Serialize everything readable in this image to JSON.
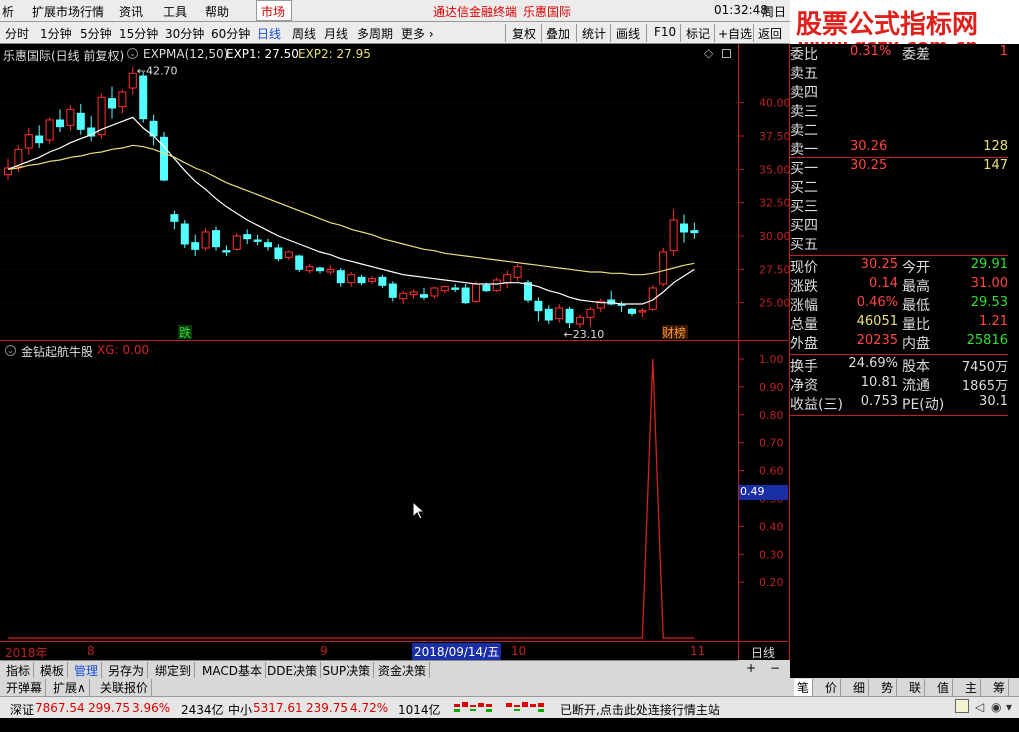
{
  "menu": {
    "items": [
      "析",
      "扩展市场行情",
      "资讯",
      "工具",
      "帮助"
    ],
    "market": "市场",
    "center": "通达信金融终端",
    "stock_title": "乐惠国际",
    "time": "01:32:48",
    "weekday": "周日"
  },
  "banner": {
    "line1": "股票公式指标网",
    "line2": "www.gszx.com.cn"
  },
  "toolbar": {
    "periods": [
      "分时",
      "1分钟",
      "5分钟",
      "15分钟",
      "30分钟",
      "60分钟",
      "日线",
      "周线",
      "月线",
      "多周期",
      "更多"
    ],
    "active": "日线",
    "right": [
      "复权",
      "叠加",
      "统计",
      "画线",
      "F10",
      "标记",
      "+自选",
      "返回"
    ]
  },
  "main_chart": {
    "header": "乐惠国际(日线 前复权)",
    "indicator": "EXPMA(12,50)",
    "exp1_label": "EXP1: 27.50",
    "exp2_label": "EXP2: 27.95",
    "high_label": "42.70",
    "low_label": "23.10",
    "tag_left": "跌",
    "tag_right": "财榜"
  },
  "indicator_chart": {
    "name": "金钻起航牛股",
    "value": "XG: 0.00",
    "cursor_value": "0.49"
  },
  "dates": {
    "year": "2018年",
    "m8": "8",
    "m9": "9",
    "cursor_date": "2018/09/14/五",
    "m10": "10",
    "m11": "11",
    "period": "日线"
  },
  "chart_data": [
    {
      "type": "candlestick",
      "title": "乐惠国际(日线 前复权)",
      "indicator": "EXPMA(12,50)",
      "ylim": [
        22.5,
        43.5
      ],
      "yticks": [
        25.0,
        27.5,
        30.0,
        32.5,
        35.0,
        37.5,
        40.0
      ],
      "ohlc": [
        [
          34.6,
          35.8,
          34.2,
          35.1
        ],
        [
          35.2,
          36.8,
          34.8,
          36.5
        ],
        [
          36.6,
          38.1,
          36.1,
          37.6
        ],
        [
          37.5,
          38.3,
          36.6,
          37.0
        ],
        [
          37.2,
          38.9,
          36.9,
          38.7
        ],
        [
          38.7,
          39.5,
          37.8,
          38.2
        ],
        [
          38.3,
          39.8,
          37.9,
          39.5
        ],
        [
          39.2,
          39.9,
          37.6,
          38.0
        ],
        [
          38.1,
          39.0,
          37.1,
          37.5
        ],
        [
          37.6,
          40.7,
          37.3,
          40.4
        ],
        [
          40.3,
          41.2,
          38.8,
          39.6
        ],
        [
          39.7,
          41.0,
          39.2,
          40.8
        ],
        [
          41.1,
          42.7,
          40.6,
          42.2
        ],
        [
          42.0,
          42.3,
          38.5,
          38.8
        ],
        [
          38.6,
          39.1,
          36.8,
          37.5
        ],
        [
          37.4,
          37.8,
          34.1,
          34.2
        ],
        [
          31.6,
          31.9,
          30.5,
          31.1
        ],
        [
          30.9,
          31.2,
          29.1,
          29.4
        ],
        [
          29.5,
          30.1,
          28.5,
          29.0
        ],
        [
          29.1,
          30.6,
          28.9,
          30.3
        ],
        [
          30.4,
          30.7,
          28.9,
          29.2
        ],
        [
          28.9,
          29.3,
          28.5,
          28.8
        ],
        [
          29.0,
          30.2,
          28.9,
          30.0
        ],
        [
          30.1,
          30.5,
          29.4,
          29.8
        ],
        [
          29.7,
          30.1,
          29.3,
          29.6
        ],
        [
          29.5,
          29.8,
          28.9,
          29.2
        ],
        [
          29.1,
          29.4,
          28.1,
          28.3
        ],
        [
          28.4,
          28.9,
          28.2,
          28.8
        ],
        [
          28.5,
          28.6,
          27.3,
          27.5
        ],
        [
          27.4,
          27.9,
          27.2,
          27.7
        ],
        [
          27.6,
          27.7,
          27.2,
          27.4
        ],
        [
          27.3,
          27.8,
          27.1,
          27.5
        ],
        [
          27.4,
          27.6,
          26.2,
          26.5
        ],
        [
          26.5,
          27.3,
          26.2,
          27.1
        ],
        [
          26.9,
          27.1,
          26.3,
          26.5
        ],
        [
          26.6,
          27.0,
          26.4,
          26.8
        ],
        [
          26.9,
          27.1,
          26.1,
          26.3
        ],
        [
          26.4,
          26.6,
          25.1,
          25.4
        ],
        [
          25.3,
          25.9,
          24.9,
          25.7
        ],
        [
          25.6,
          26.0,
          25.3,
          25.8
        ],
        [
          25.6,
          26.1,
          25.2,
          25.4
        ],
        [
          25.5,
          26.2,
          25.3,
          26.1
        ],
        [
          25.9,
          26.3,
          25.7,
          26.2
        ],
        [
          26.1,
          26.4,
          25.8,
          26.0
        ],
        [
          26.1,
          26.4,
          24.9,
          25.0
        ],
        [
          25.1,
          26.6,
          25.0,
          26.4
        ],
        [
          26.3,
          26.5,
          25.8,
          25.9
        ],
        [
          25.9,
          26.9,
          25.8,
          26.7
        ],
        [
          26.5,
          27.4,
          26.1,
          27.1
        ],
        [
          26.9,
          27.9,
          26.6,
          27.7
        ],
        [
          26.5,
          26.7,
          25.0,
          25.2
        ],
        [
          25.1,
          25.4,
          23.6,
          24.4
        ],
        [
          24.5,
          24.8,
          23.4,
          23.7
        ],
        [
          23.8,
          24.9,
          23.5,
          24.6
        ],
        [
          24.5,
          24.7,
          23.1,
          23.5
        ],
        [
          23.4,
          24.1,
          23.1,
          23.9
        ],
        [
          23.9,
          24.7,
          23.2,
          24.5
        ],
        [
          24.6,
          25.3,
          24.3,
          25.1
        ],
        [
          25.2,
          25.9,
          24.8,
          24.9
        ],
        [
          24.9,
          25.1,
          24.3,
          24.8
        ],
        [
          24.5,
          24.6,
          24.0,
          24.2
        ],
        [
          24.3,
          24.6,
          23.9,
          24.4
        ],
        [
          24.5,
          26.3,
          24.4,
          26.1
        ],
        [
          26.4,
          29.1,
          26.2,
          28.8
        ],
        [
          28.9,
          32.0,
          28.5,
          31.2
        ],
        [
          30.9,
          31.6,
          29.5,
          30.3
        ],
        [
          30.4,
          31.0,
          29.8,
          30.25
        ]
      ],
      "series": [
        {
          "name": "EXP1",
          "color": "#ffffff",
          "values": [
            35.0,
            35.3,
            35.6,
            35.9,
            36.3,
            36.6,
            37.0,
            37.3,
            37.6,
            38.0,
            38.3,
            38.6,
            38.9,
            38.1,
            37.5,
            36.7,
            35.8,
            34.9,
            34.1,
            33.5,
            32.8,
            32.2,
            31.7,
            31.2,
            30.8,
            30.4,
            30.0,
            29.7,
            29.4,
            29.1,
            28.8,
            28.6,
            28.3,
            28.1,
            27.9,
            27.7,
            27.5,
            27.3,
            27.1,
            27.0,
            26.9,
            26.8,
            26.7,
            26.6,
            26.5,
            26.4,
            26.4,
            26.4,
            26.5,
            26.5,
            26.4,
            26.2,
            25.9,
            25.7,
            25.4,
            25.2,
            25.1,
            25.0,
            25.0,
            24.9,
            24.9,
            24.9,
            25.2,
            25.8,
            26.5,
            27.0,
            27.5
          ]
        },
        {
          "name": "EXP2",
          "color": "#e8e07a",
          "values": [
            35.0,
            35.1,
            35.3,
            35.4,
            35.6,
            35.7,
            35.9,
            36.0,
            36.2,
            36.3,
            36.5,
            36.6,
            36.8,
            36.7,
            36.5,
            36.2,
            35.9,
            35.5,
            35.1,
            34.8,
            34.4,
            34.0,
            33.7,
            33.4,
            33.1,
            32.8,
            32.5,
            32.2,
            31.9,
            31.6,
            31.3,
            31.0,
            30.8,
            30.5,
            30.3,
            30.1,
            29.8,
            29.6,
            29.4,
            29.2,
            29.0,
            28.9,
            28.7,
            28.6,
            28.5,
            28.4,
            28.3,
            28.2,
            28.1,
            28.0,
            27.9,
            27.8,
            27.7,
            27.6,
            27.5,
            27.4,
            27.3,
            27.3,
            27.2,
            27.2,
            27.1,
            27.1,
            27.2,
            27.4,
            27.6,
            27.8,
            27.95
          ]
        }
      ]
    },
    {
      "type": "line",
      "title": "金钻起航牛股",
      "ylim": [
        0.0,
        1.05
      ],
      "yticks": [
        0.2,
        0.3,
        0.4,
        0.5,
        0.6,
        0.7,
        0.8,
        0.9,
        1.0
      ],
      "series": [
        {
          "name": "XG",
          "color": "#d22222",
          "values": [
            0,
            0,
            0,
            0,
            0,
            0,
            0,
            0,
            0,
            0,
            0,
            0,
            0,
            0,
            0,
            0,
            0,
            0,
            0,
            0,
            0,
            0,
            0,
            0,
            0,
            0,
            0,
            0,
            0,
            0,
            0,
            0,
            0,
            0,
            0,
            0,
            0,
            0,
            0,
            0,
            0,
            0,
            0,
            0,
            0,
            0,
            0,
            0,
            0,
            0,
            0,
            0,
            0,
            0,
            0,
            0,
            0,
            0,
            0,
            0,
            0,
            0,
            1,
            0,
            0,
            0,
            0
          ]
        }
      ]
    }
  ],
  "quote": {
    "top": [
      {
        "l": "委比",
        "v": "0.31%",
        "l2": "委差",
        "v2": "1"
      }
    ],
    "ask": [
      {
        "l": "卖五"
      },
      {
        "l": "卖四"
      },
      {
        "l": "卖三"
      },
      {
        "l": "卖二"
      },
      {
        "l": "卖一",
        "p": "30.26",
        "q": "128"
      }
    ],
    "bid": [
      {
        "l": "买一",
        "p": "30.25",
        "q": "147"
      },
      {
        "l": "买二"
      },
      {
        "l": "买三"
      },
      {
        "l": "买四"
      },
      {
        "l": "买五"
      }
    ],
    "stats": [
      {
        "l": "现价",
        "v": "30.25",
        "l2": "今开",
        "v2": "29.91",
        "c": "#ff4444",
        "c2": "#33dd33"
      },
      {
        "l": "涨跌",
        "v": "0.14",
        "l2": "最高",
        "v2": "31.00",
        "c": "#ff4444",
        "c2": "#ff4444"
      },
      {
        "l": "涨幅",
        "v": "0.46%",
        "l2": "最低",
        "v2": "29.53",
        "c": "#ff4444",
        "c2": "#33dd33"
      },
      {
        "l": "总量",
        "v": "46051",
        "l2": "量比",
        "v2": "1.21",
        "c": "#e8e07a",
        "c2": "#ff4444"
      },
      {
        "l": "外盘",
        "v": "20235",
        "l2": "内盘",
        "v2": "25816",
        "c": "#ff4444",
        "c2": "#33dd33"
      }
    ],
    "fin": [
      {
        "l": "换手",
        "v": "24.69%",
        "l2": "股本",
        "v2": "7450万"
      },
      {
        "l": "净资",
        "v": "10.81",
        "l2": "流通",
        "v2": "1865万"
      },
      {
        "l": "收益(三)",
        "v": "0.753",
        "l2": "PE(动)",
        "v2": "30.1"
      }
    ]
  },
  "tabs": [
    "指标",
    "模板",
    "管理",
    "另存为",
    "绑定到",
    "MACD基本",
    "DDE决策",
    "SUP决策",
    "资金决策"
  ],
  "tabs2": [
    "开弹幕",
    "扩展∧",
    "关联报价"
  ],
  "rtabs": [
    "笔",
    "价",
    "细",
    "势",
    "联",
    "值",
    "主",
    "筹"
  ],
  "status": {
    "sz_label": "深证",
    "sz_val": "7867.54",
    "sz_chg": "299.75",
    "sz_pct": "3.96%",
    "sz_amt": "2434亿",
    "zx_label": "中小",
    "zx_val": "5317.61",
    "zx_chg": "239.75",
    "zx_pct": "4.72%",
    "zx_amt": "1014亿",
    "msg": "已断开,点击此处连接行情主站"
  }
}
